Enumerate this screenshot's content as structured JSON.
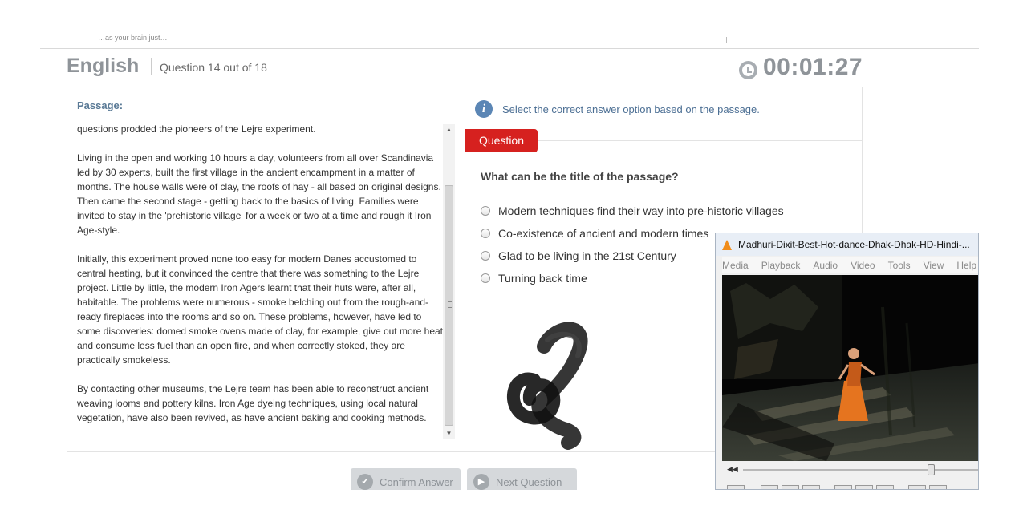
{
  "header": {
    "faded_text": "…as your brain just…",
    "subject": "English",
    "question_counter": "Question 14 out of 18",
    "timer": "00:01:27"
  },
  "passage": {
    "heading": "Passage:",
    "paragraphs": [
      "questions prodded the pioneers of the Lejre experiment.",
      "Living in the open and working 10 hours a day, volunteers from all over Scandinavia led by 30 experts, built the first village in the ancient encampment in a matter of months. The house walls were of clay, the roofs of hay - all based on original designs. Then came the second stage - getting back to the basics of living. Families were invited to stay in the 'prehistoric village' for a week or two at a time and rough it Iron Age-style.",
      "Initially, this experiment proved none too easy for modern Danes accustomed to central heating, but it convinced the centre that there was something to the Lejre project. Little by little, the modern Iron Agers learnt that their huts were, after all, habitable. The problems were numerous - smoke belching out from the rough-and-ready fireplaces into the rooms and so on. These problems, however, have led to some discoveries: domed smoke ovens made of clay, for example, give out more heat and consume less fuel than an open fire, and when correctly stoked, they are practically smokeless.",
      "By contacting other museums, the Lejre team has been able to reconstruct ancient weaving looms and pottery kilns. Iron Age dyeing techniques, using local natural vegetation, have also been revived, as have ancient baking and cooking methods."
    ]
  },
  "question": {
    "instruction": "Select the correct answer option based on the passage.",
    "tab_label": "Question",
    "text": "What can be the title of the passage?",
    "options": [
      "Modern techniques find their way into pre-historic villages",
      "Co-existence of ancient and modern times",
      "Glad to be living in the 21st Century",
      "Turning back time"
    ]
  },
  "buttons": {
    "confirm": "Confirm Answer",
    "next": "Next Question"
  },
  "vlc": {
    "title": "Madhuri-Dixit-Best-Hot-dance-Dhak-Dhak-HD-Hindi-...",
    "menu": [
      "Media",
      "Playback",
      "Audio",
      "Video",
      "Tools",
      "View",
      "Help"
    ],
    "seek_position": 0.78
  },
  "colors": {
    "accent_red": "#d6211f",
    "info_blue": "#5b86b5",
    "heading_gray": "#8f9499"
  }
}
